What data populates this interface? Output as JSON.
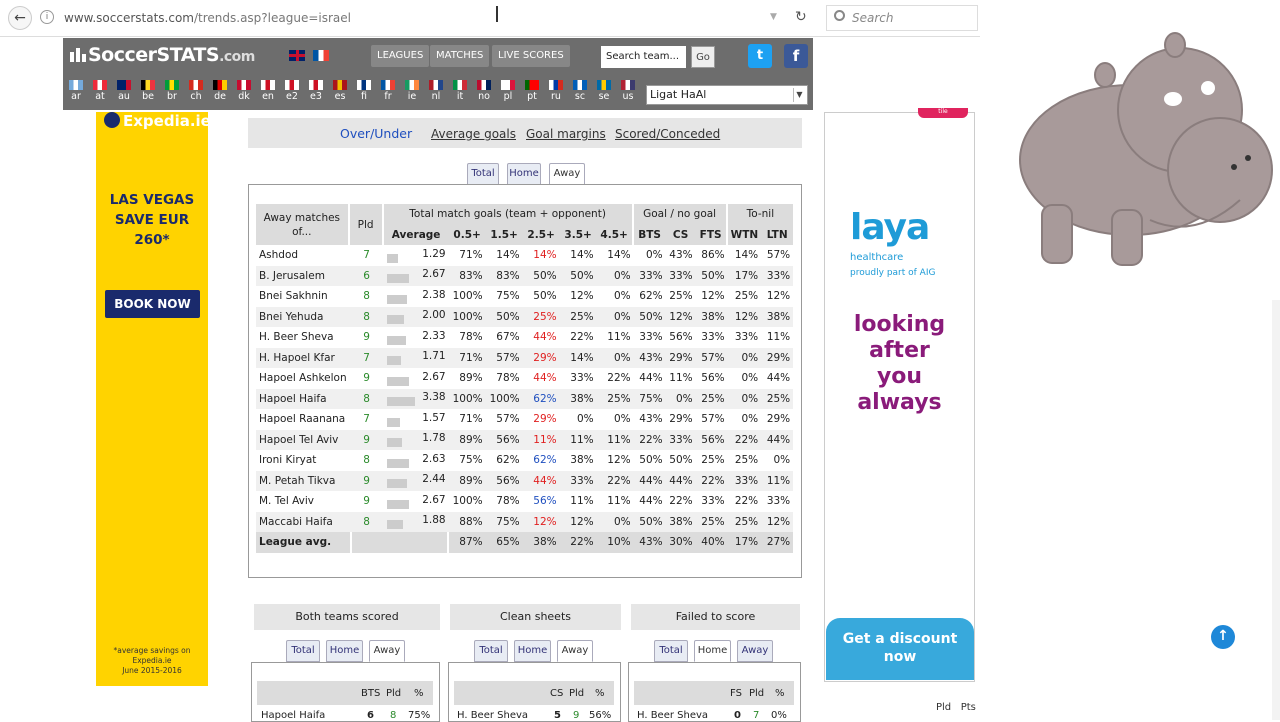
{
  "browser": {
    "url_host": "www.soccerstats.com",
    "url_path": "/trends.asp?league=israel",
    "search_placeholder": "Search"
  },
  "site": {
    "logo_main": "SoccerSTATS",
    "logo_suffix": ".com",
    "nav": [
      "LEAGUES",
      "MATCHES",
      "LIVE SCORES"
    ],
    "search_team": "Search team...",
    "go": "Go",
    "twitter": "t",
    "facebook": "f",
    "countries": [
      "ar",
      "at",
      "au",
      "be",
      "br",
      "ch",
      "de",
      "dk",
      "en",
      "e2",
      "e3",
      "es",
      "fi",
      "fr",
      "ie",
      "nl",
      "it",
      "no",
      "pl",
      "pt",
      "ru",
      "sc",
      "se",
      "us"
    ],
    "league_select": "Ligat HaAl"
  },
  "left_ad": {
    "brand": "Expedia.ie",
    "headline_1": "LAS VEGAS",
    "headline_2": "SAVE EUR 260*",
    "button": "BOOK NOW",
    "footnote_1": "*average savings on",
    "footnote_2": "Expedia.ie",
    "footnote_3": "June 2015-2016"
  },
  "menu": {
    "over_under": "Over/Under",
    "average_goals": "Average goals",
    "goal_margins": "Goal margins",
    "scored_conceded": "Scored/Conceded"
  },
  "tabs": {
    "total": "Total",
    "home": "Home",
    "away": "Away"
  },
  "table": {
    "h_team": "Away matches of...",
    "h_pld": "Pld",
    "h_total": "Total match goals (team + opponent)",
    "h_goal": "Goal / no goal",
    "h_tonil": "To-nil",
    "cols": [
      "Average",
      "0.5+",
      "1.5+",
      "2.5+",
      "3.5+",
      "4.5+",
      "BTS",
      "CS",
      "FTS",
      "WTN",
      "LTN"
    ],
    "rows": [
      {
        "team": "Ashdod",
        "pld": "7",
        "avg": "1.29",
        "bar": 0.38,
        "o05": "71%",
        "o15": "14%",
        "o25": "14%",
        "c25": "red",
        "o35": "14%",
        "o45": "14%",
        "bts": "0%",
        "cs": "43%",
        "fts": "86%",
        "wtn": "14%",
        "ltn": "57%"
      },
      {
        "team": "B. Jerusalem",
        "pld": "6",
        "avg": "2.67",
        "bar": 0.79,
        "o05": "83%",
        "o15": "83%",
        "o25": "50%",
        "c25": "",
        "o35": "50%",
        "o45": "0%",
        "bts": "33%",
        "cs": "33%",
        "fts": "50%",
        "wtn": "17%",
        "ltn": "33%"
      },
      {
        "team": "Bnei Sakhnin",
        "pld": "8",
        "avg": "2.38",
        "bar": 0.7,
        "o05": "100%",
        "o15": "75%",
        "o25": "50%",
        "c25": "",
        "o35": "12%",
        "o45": "0%",
        "bts": "62%",
        "cs": "25%",
        "fts": "12%",
        "wtn": "25%",
        "ltn": "12%"
      },
      {
        "team": "Bnei Yehuda",
        "pld": "8",
        "avg": "2.00",
        "bar": 0.59,
        "o05": "100%",
        "o15": "50%",
        "o25": "25%",
        "c25": "red",
        "o35": "25%",
        "o45": "0%",
        "bts": "50%",
        "cs": "12%",
        "fts": "38%",
        "wtn": "12%",
        "ltn": "38%"
      },
      {
        "team": "H. Beer Sheva",
        "pld": "9",
        "avg": "2.33",
        "bar": 0.69,
        "o05": "78%",
        "o15": "67%",
        "o25": "44%",
        "c25": "red",
        "o35": "22%",
        "o45": "11%",
        "bts": "33%",
        "cs": "56%",
        "fts": "33%",
        "wtn": "33%",
        "ltn": "11%"
      },
      {
        "team": "H. Hapoel Kfar",
        "pld": "7",
        "avg": "1.71",
        "bar": 0.5,
        "o05": "71%",
        "o15": "57%",
        "o25": "29%",
        "c25": "red",
        "o35": "14%",
        "o45": "0%",
        "bts": "43%",
        "cs": "29%",
        "fts": "57%",
        "wtn": "0%",
        "ltn": "29%"
      },
      {
        "team": "Hapoel Ashkelon",
        "pld": "9",
        "avg": "2.67",
        "bar": 0.79,
        "o05": "89%",
        "o15": "78%",
        "o25": "44%",
        "c25": "red",
        "o35": "33%",
        "o45": "22%",
        "bts": "44%",
        "cs": "11%",
        "fts": "56%",
        "wtn": "0%",
        "ltn": "44%"
      },
      {
        "team": "Hapoel Haifa",
        "pld": "8",
        "avg": "3.38",
        "bar": 1.0,
        "o05": "100%",
        "o15": "100%",
        "o25": "62%",
        "c25": "blue",
        "o35": "38%",
        "o45": "25%",
        "bts": "75%",
        "cs": "0%",
        "fts": "25%",
        "wtn": "0%",
        "ltn": "25%"
      },
      {
        "team": "Hapoel Raanana",
        "pld": "7",
        "avg": "1.57",
        "bar": 0.46,
        "o05": "71%",
        "o15": "57%",
        "o25": "29%",
        "c25": "red",
        "o35": "0%",
        "o45": "0%",
        "bts": "43%",
        "cs": "29%",
        "fts": "57%",
        "wtn": "0%",
        "ltn": "29%"
      },
      {
        "team": "Hapoel Tel Aviv",
        "pld": "9",
        "avg": "1.78",
        "bar": 0.53,
        "o05": "89%",
        "o15": "56%",
        "o25": "11%",
        "c25": "red",
        "o35": "11%",
        "o45": "11%",
        "bts": "22%",
        "cs": "33%",
        "fts": "56%",
        "wtn": "22%",
        "ltn": "44%"
      },
      {
        "team": "Ironi Kiryat",
        "pld": "8",
        "avg": "2.63",
        "bar": 0.78,
        "o05": "75%",
        "o15": "62%",
        "o25": "62%",
        "c25": "blue",
        "o35": "38%",
        "o45": "12%",
        "bts": "50%",
        "cs": "50%",
        "fts": "25%",
        "wtn": "25%",
        "ltn": "0%"
      },
      {
        "team": "M. Petah Tikva",
        "pld": "9",
        "avg": "2.44",
        "bar": 0.72,
        "o05": "89%",
        "o15": "56%",
        "o25": "44%",
        "c25": "red",
        "o35": "33%",
        "o45": "22%",
        "bts": "44%",
        "cs": "44%",
        "fts": "22%",
        "wtn": "33%",
        "ltn": "11%"
      },
      {
        "team": "M. Tel Aviv",
        "pld": "9",
        "avg": "2.67",
        "bar": 0.79,
        "o05": "100%",
        "o15": "78%",
        "o25": "56%",
        "c25": "blue",
        "o35": "11%",
        "o45": "11%",
        "bts": "44%",
        "cs": "22%",
        "fts": "33%",
        "wtn": "22%",
        "ltn": "33%"
      },
      {
        "team": "Maccabi Haifa",
        "pld": "8",
        "avg": "1.88",
        "bar": 0.56,
        "o05": "88%",
        "o15": "75%",
        "o25": "12%",
        "c25": "red",
        "o35": "12%",
        "o45": "0%",
        "bts": "50%",
        "cs": "38%",
        "fts": "25%",
        "wtn": "25%",
        "ltn": "12%"
      }
    ],
    "league_avg": {
      "label": "League avg.",
      "o05": "87%",
      "o15": "65%",
      "o25": "38%",
      "o35": "22%",
      "o45": "10%",
      "bts": "43%",
      "cs": "30%",
      "fts": "40%",
      "wtn": "17%",
      "ltn": "27%"
    }
  },
  "bottom": {
    "bts_title": "Both teams scored",
    "cs_title": "Clean sheets",
    "fts_title": "Failed to score",
    "bts_cols": [
      "BTS",
      "Pld",
      "%"
    ],
    "cs_cols": [
      "CS",
      "Pld",
      "%"
    ],
    "fts_cols": [
      "FS",
      "Pld",
      "%"
    ],
    "bts_row": {
      "team": "Hapoel Haifa",
      "a": "6",
      "b": "8",
      "c": "75%"
    },
    "cs_row": {
      "team": "H. Beer Sheva",
      "a": "5",
      "b": "9",
      "c": "56%"
    },
    "fts_row": {
      "team": "H. Beer Sheva",
      "a": "0",
      "b": "7",
      "c": "0%"
    }
  },
  "right_ad": {
    "top_tag": "tile",
    "brand": "laya",
    "brand_sub": "healthcare",
    "part_of": "proudly part of AIG",
    "line1": "looking",
    "line2": "after",
    "line3": "you",
    "line4": "always",
    "cta": "Get a discount now",
    "pld": "Pld",
    "pts": "Pts"
  },
  "colors": {
    "red": "#e02020",
    "blue": "#1f4fbf",
    "green": "#2a8a2a",
    "header": "#6d6d6d"
  }
}
